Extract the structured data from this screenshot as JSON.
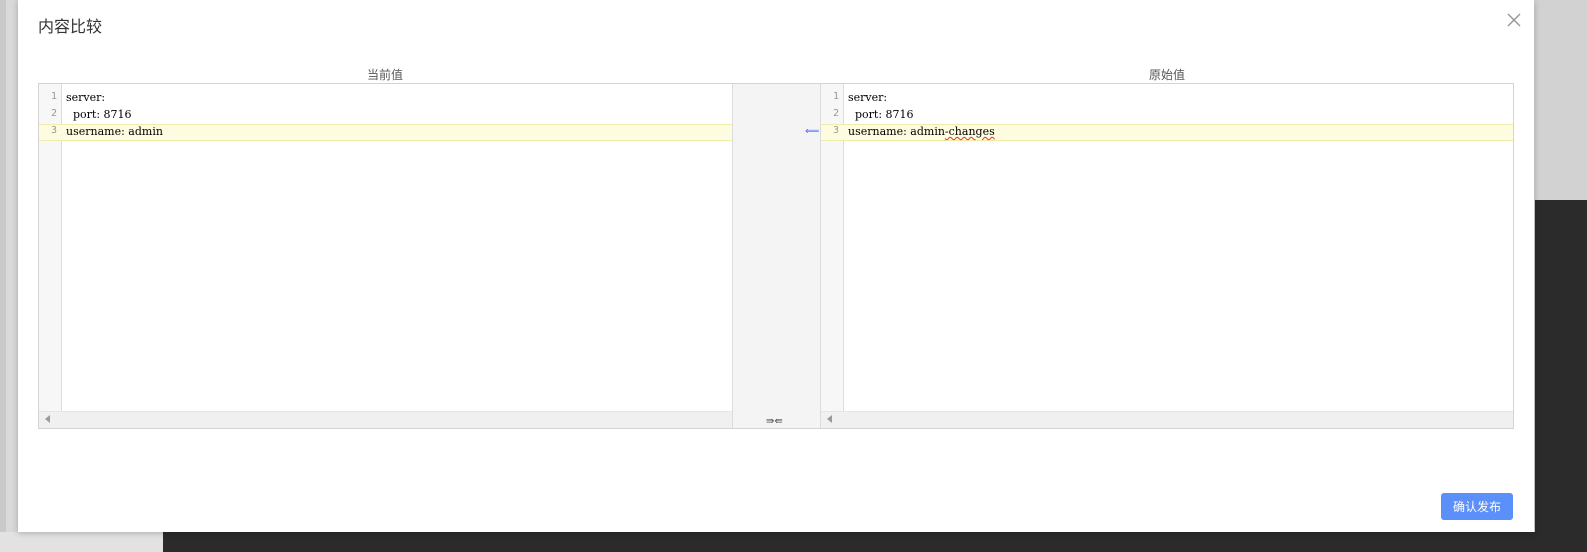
{
  "modal": {
    "title": "内容比较",
    "close_icon": "close-icon",
    "confirm_label": "确认发布"
  },
  "left_pane": {
    "label": "当前值",
    "lines": [
      {
        "number": "1",
        "text": "server:"
      },
      {
        "number": "2",
        "text": "  port: 8716"
      },
      {
        "number": "3",
        "text": "username: admin"
      }
    ]
  },
  "right_pane": {
    "label": "原始值",
    "lines": [
      {
        "number": "1",
        "text": "server:"
      },
      {
        "number": "2",
        "text": "  port: 8716"
      },
      {
        "number": "3",
        "text_prefix": "username: admin",
        "text_squiggle": "-changes"
      }
    ]
  },
  "gap": {
    "revert_icon": "revert-arrow-icon",
    "revert_glyph": "⟸",
    "sync_icon": "sync-scroll-icon",
    "sync_glyph": "⇛⇚"
  },
  "colors": {
    "accent": "#5b8ff9",
    "changed_line_bg": "#fefce0",
    "revert_arrow": "#4466ff",
    "spelling_underline": "#dd3333"
  }
}
